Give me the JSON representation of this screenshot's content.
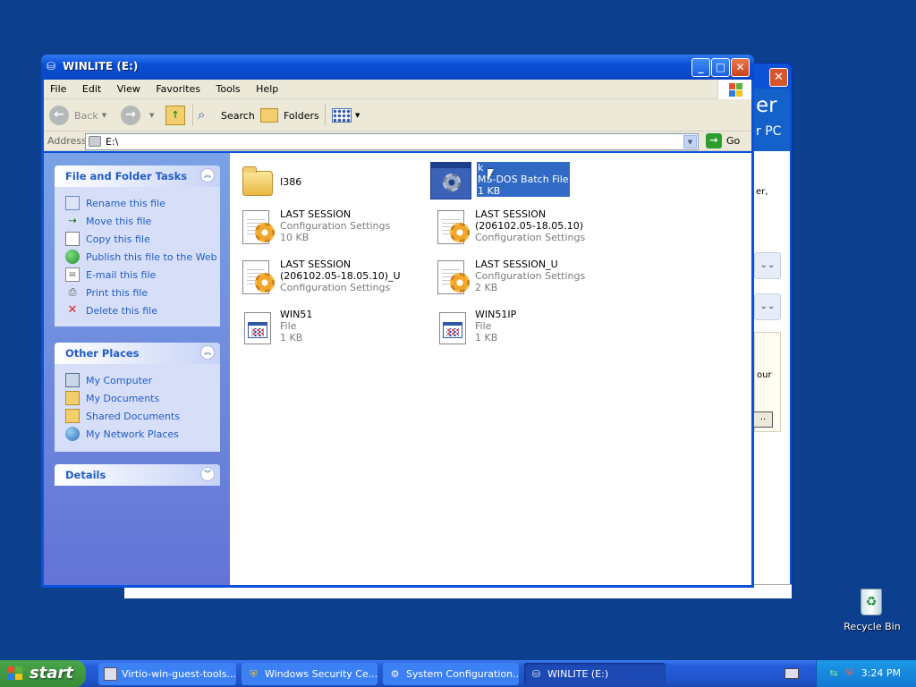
{
  "background_window": {
    "frag_er": "er",
    "frag_pc": "r PC",
    "frag_text1": "er,",
    "frag_text2": "our",
    "frag_btn": ".."
  },
  "window": {
    "title": "WINLITE (E:)"
  },
  "menu": [
    "File",
    "Edit",
    "View",
    "Favorites",
    "Tools",
    "Help"
  ],
  "toolbar": {
    "back_label": "Back",
    "search_label": "Search",
    "folders_label": "Folders"
  },
  "address": {
    "label": "Address",
    "value": "E:\\",
    "go_label": "Go"
  },
  "file_folder_tasks": {
    "title": "File and Folder Tasks",
    "items": [
      {
        "label": "Rename this file",
        "icon": "rename-icon"
      },
      {
        "label": "Move this file",
        "icon": "move-icon"
      },
      {
        "label": "Copy this file",
        "icon": "copy-icon"
      },
      {
        "label": "Publish this file to the Web",
        "icon": "globe-icon"
      },
      {
        "label": "E-mail this file",
        "icon": "email-icon"
      },
      {
        "label": "Print this file",
        "icon": "printer-icon"
      },
      {
        "label": "Delete this file",
        "icon": "delete-icon"
      }
    ]
  },
  "other_places": {
    "title": "Other Places",
    "items": [
      {
        "label": "My Computer",
        "icon": "computer-icon"
      },
      {
        "label": "My Documents",
        "icon": "documents-folder-icon"
      },
      {
        "label": "Shared Documents",
        "icon": "shared-folder-icon"
      },
      {
        "label": "My Network Places",
        "icon": "network-icon"
      }
    ]
  },
  "details": {
    "title": "Details"
  },
  "files": [
    {
      "name": "I386",
      "line2": "",
      "line3": "",
      "icon": "folder-icon"
    },
    {
      "name": "k",
      "line2": "MS-DOS Batch File",
      "line3": "1 KB",
      "icon": "batch-file-icon",
      "selected": true
    },
    {
      "name": "LAST SESSION",
      "line2": "Configuration Settings",
      "line3": "10 KB",
      "icon": "config-file-icon"
    },
    {
      "name": "LAST SESSION",
      "name2": "(206102.05-18.05.10)",
      "line2": "Configuration Settings",
      "icon": "config-file-icon"
    },
    {
      "name": "LAST SESSION",
      "name2": "(206102.05-18.05.10)_U",
      "line2": "Configuration Settings",
      "icon": "config-file-icon"
    },
    {
      "name": "LAST SESSION_U",
      "line2": "Configuration Settings",
      "line3": "2 KB",
      "icon": "config-file-icon"
    },
    {
      "name": "WIN51",
      "line2": "File",
      "line3": "1 KB",
      "icon": "generic-file-icon"
    },
    {
      "name": "WIN51IP",
      "line2": "File",
      "line3": "1 KB",
      "icon": "generic-file-icon"
    }
  ],
  "desktop": {
    "recycle_bin_label": "Recycle Bin"
  },
  "taskbar": {
    "start_label": "start",
    "tasks": [
      {
        "label": "Virtio-win-guest-tools...",
        "icon": "installer-icon",
        "active": false
      },
      {
        "label": "Windows Security Ce...",
        "icon": "shield-icon",
        "active": false
      },
      {
        "label": "System Configuration...",
        "icon": "config-tool-icon",
        "active": false
      },
      {
        "label": "WINLITE (E:)",
        "icon": "drive-icon",
        "active": true
      }
    ],
    "clock": "3:24 PM"
  },
  "colors": {
    "desktop": "#0d3f8f",
    "taskbar": "#245edb",
    "start_button": "#378c36",
    "task_link": "#215dc6",
    "selection": "#316ac5"
  }
}
